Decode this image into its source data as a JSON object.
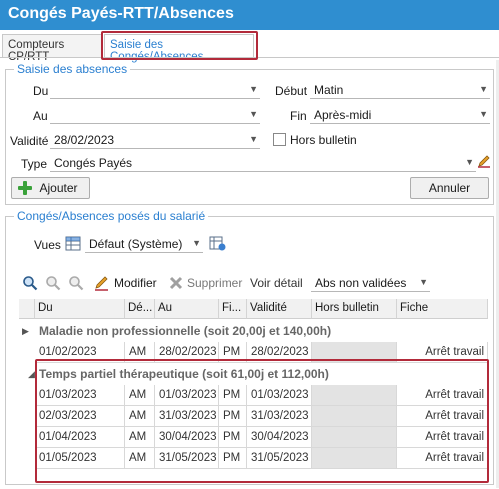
{
  "title": "Congés Payés-RTT/Absences",
  "tabs": [
    {
      "label": "Compteurs CP/RTT"
    },
    {
      "label": "Saisie des Congés/Absences"
    }
  ],
  "saisie": {
    "legend": "Saisie des absences",
    "du": {
      "label": "Du",
      "value": ""
    },
    "au": {
      "label": "Au",
      "value": ""
    },
    "validite": {
      "label": "Validité",
      "value": "28/02/2023"
    },
    "type": {
      "label": "Type",
      "value": "Congés Payés"
    },
    "debut": {
      "label": "Début",
      "value": "Matin"
    },
    "fin": {
      "label": "Fin",
      "value": "Après-midi"
    },
    "hors_bulletin": {
      "label": "Hors bulletin",
      "checked": false
    },
    "ajouter_label": "Ajouter",
    "annuler_label": "Annuler"
  },
  "poses": {
    "legend": "Congés/Absences posés du salarié",
    "vues_label": "Vues",
    "vues_value": "Défaut (Système)",
    "toolbar": {
      "modifier": "Modifier",
      "supprimer": "Supprimer",
      "voir_detail": "Voir détail",
      "filter_value": "Abs non validées"
    },
    "columns": [
      "Du",
      "Dé...",
      "Au",
      "Fi...",
      "Validité",
      "Hors bulletin",
      "Fiche"
    ],
    "groups": [
      {
        "title": "Maladie non professionnelle (soit 20,00j et 140,00h)",
        "rows": [
          {
            "du": "01/02/2023",
            "debut": "AM",
            "au": "28/02/2023",
            "fin": "PM",
            "validite": "28/02/2023",
            "hors": "",
            "fiche": "Arrêt travail"
          }
        ]
      },
      {
        "title": "Temps partiel thérapeutique (soit 61,00j et 112,00h)",
        "rows": [
          {
            "du": "01/03/2023",
            "debut": "AM",
            "au": "01/03/2023",
            "fin": "PM",
            "validite": "01/03/2023",
            "hors": "",
            "fiche": "Arrêt travail"
          },
          {
            "du": "02/03/2023",
            "debut": "AM",
            "au": "31/03/2023",
            "fin": "PM",
            "validite": "31/03/2023",
            "hors": "",
            "fiche": "Arrêt travail"
          },
          {
            "du": "01/04/2023",
            "debut": "AM",
            "au": "30/04/2023",
            "fin": "PM",
            "validite": "30/04/2023",
            "hors": "",
            "fiche": "Arrêt travail"
          },
          {
            "du": "01/05/2023",
            "debut": "AM",
            "au": "31/05/2023",
            "fin": "PM",
            "validite": "31/05/2023",
            "hors": "",
            "fiche": "Arrêt travail"
          }
        ]
      }
    ]
  }
}
